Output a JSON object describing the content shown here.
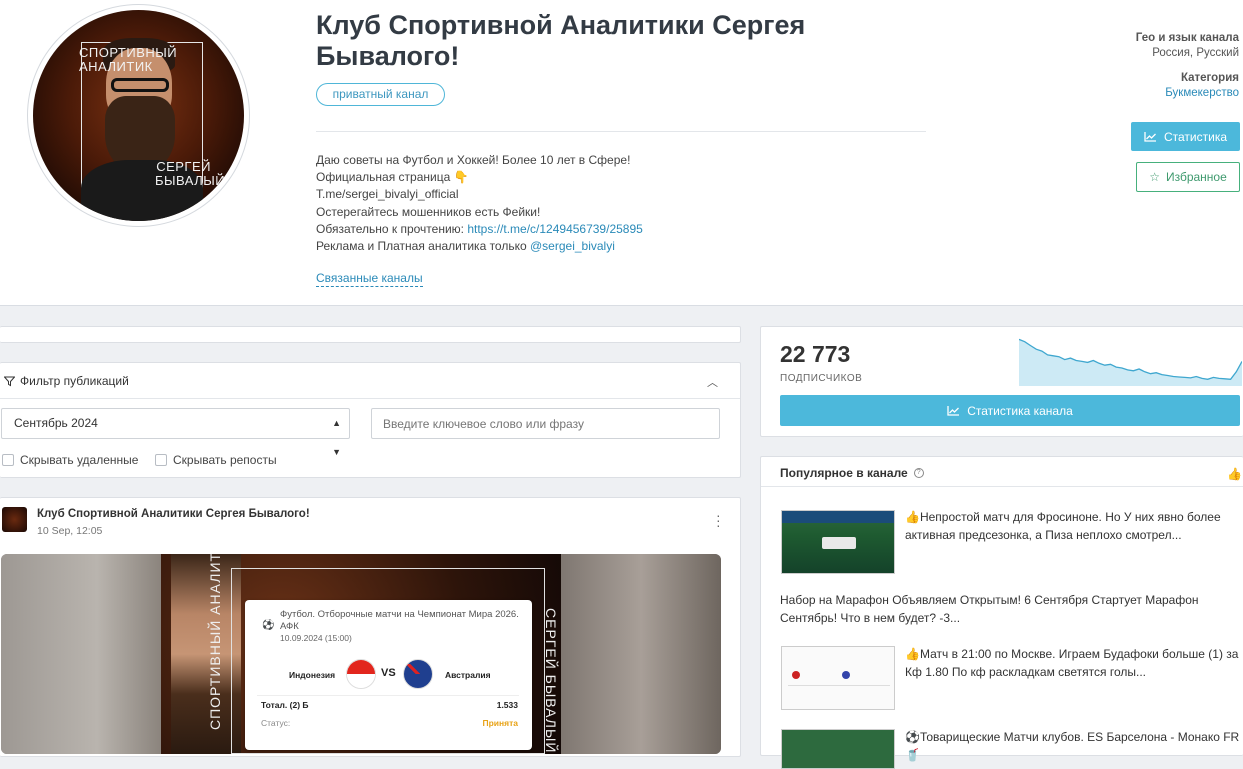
{
  "channel": {
    "title": "Клуб Спортивной Аналитики Сергея Бывалого!",
    "badge": "приватный канал",
    "avatar_text_top": "СПОРТИВНЫЙ АНАЛИТИК",
    "avatar_text_bottom": "СЕРГЕЙ БЫВАЛЫЙ",
    "description": {
      "line1": "Даю советы на Футбол и Хоккей! Более 10 лет в Сфере!",
      "line2": "Официальная страница 👇",
      "line3": "T.me/sergei_bivalyi_official",
      "line4": "Остерегайтесь мошенников есть Фейки!",
      "line5_prefix": "Обязательно к прочтению: ",
      "line5_link": "https://t.me/c/1249456739/25895",
      "line6_prefix": "Реклама и Платная аналитика только ",
      "line6_link": "@sergei_bivalyi"
    },
    "related_label": "Связанные каналы"
  },
  "meta": {
    "geo_label": "Гео и язык канала",
    "geo_value": "Россия, Русский",
    "category_label": "Категория",
    "category_value": "Букмекерство",
    "stats_button": "Статистика",
    "fav_button": "Избранное"
  },
  "filter": {
    "title": "Фильтр публикаций",
    "month": "Сентябрь 2024",
    "search_placeholder": "Введите ключевое слово или фразу",
    "hide_deleted": "Скрывать удаленные",
    "hide_reposts": "Скрывать репосты"
  },
  "post": {
    "author": "Клуб Спортивной Аналитики Сергея Бывалого!",
    "date": "10 Sep, 12:05",
    "image_vtext_left": "СПОРТИВНЫЙ АНАЛИТИК",
    "image_vtext_right": "СЕРГЕЙ БЫВАЛЫЙ",
    "card": {
      "title": "Футбол. Отборочные матчи на Чемпионат Мира 2026. АФК",
      "date": "10.09.2024 (15:00)",
      "team1": "Индонезия",
      "vs": "VS",
      "team2": "Австралия",
      "bet_label": "Тотал. (2) Б",
      "bet_value": "1.533",
      "status_label": "Статус:",
      "status_value": "Принята"
    }
  },
  "subscribers": {
    "count": "22 773",
    "label": "ПОДПИСЧИКОВ",
    "button": "Статистика канала",
    "trend": [
      0.95,
      0.9,
      0.82,
      0.74,
      0.7,
      0.62,
      0.6,
      0.58,
      0.52,
      0.55,
      0.5,
      0.48,
      0.46,
      0.5,
      0.44,
      0.4,
      0.42,
      0.36,
      0.34,
      0.3,
      0.28,
      0.32,
      0.26,
      0.22,
      0.24,
      0.2,
      0.18,
      0.16,
      0.15,
      0.14,
      0.13,
      0.16,
      0.12,
      0.1,
      0.14,
      0.12,
      0.11,
      0.1,
      0.26,
      0.48
    ]
  },
  "popular": {
    "title": "Популярное в канале",
    "items": [
      "👍Непростой матч для Фросиноне. Но У них явно более активная предсезонка, а Пиза неплохо смотрел...",
      "Набор на Марафон Объявляем Открытым! 6 Сентября Стартует Марафон Сентябрь! Что в нем будет? -3...",
      "👍Матч в 21:00 по Москве. Играем Будафоки больше (1) за Кф 1.80 По кф раскладкам светятся голы...",
      "⚽Товарищеские Матчи клубов. ES Барселона - Монако FR 🥤"
    ]
  },
  "colors": {
    "accent": "#4cb8db",
    "link": "#2a8ab8",
    "success": "#46b07c",
    "status_accepted": "#e8a317"
  }
}
